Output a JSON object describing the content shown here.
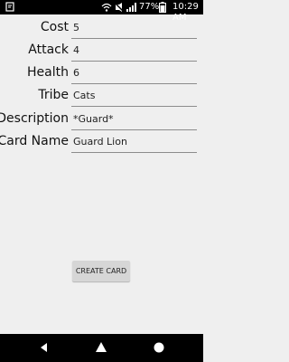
{
  "status_bar": {
    "battery_percent": "77%",
    "time": "10:29",
    "time_suffix": "AM",
    "icons": [
      "notification-icon",
      "wifi-icon",
      "silent-icon",
      "signal-icon",
      "battery-icon"
    ]
  },
  "form": {
    "cost": {
      "label": "Cost",
      "value": "5"
    },
    "attack": {
      "label": "Attack",
      "value": "4"
    },
    "health": {
      "label": "Health",
      "value": "6"
    },
    "tribe": {
      "label": "Tribe",
      "value": "Cats"
    },
    "description": {
      "label": "Description",
      "value": "*Guard*"
    },
    "card_name": {
      "label": "Card Name",
      "value": "Guard Lion"
    }
  },
  "create_button": {
    "label": "CREATE CARD"
  },
  "nav_bar": {
    "icons": [
      "back-icon",
      "home-icon",
      "recent-apps-icon"
    ]
  }
}
